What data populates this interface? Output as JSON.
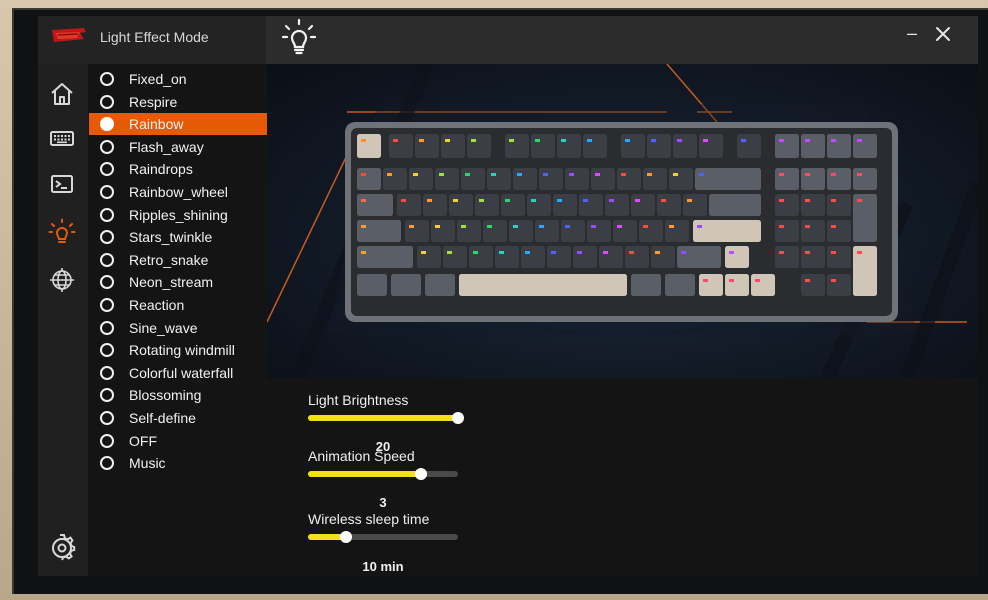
{
  "header": {
    "title": "Light Effect Mode",
    "minimize_label": "–"
  },
  "modes": {
    "selected": "Rainbow",
    "items": [
      {
        "label": "Fixed_on"
      },
      {
        "label": "Respire"
      },
      {
        "label": "Rainbow"
      },
      {
        "label": "Flash_away"
      },
      {
        "label": "Raindrops"
      },
      {
        "label": "Rainbow_wheel"
      },
      {
        "label": "Ripples_shining"
      },
      {
        "label": "Stars_twinkle"
      },
      {
        "label": "Retro_snake"
      },
      {
        "label": "Neon_stream"
      },
      {
        "label": "Reaction"
      },
      {
        "label": "Sine_wave"
      },
      {
        "label": "Rotating windmill"
      },
      {
        "label": "Colorful waterfall"
      },
      {
        "label": "Blossoming"
      },
      {
        "label": "Self-define"
      },
      {
        "label": "OFF"
      },
      {
        "label": "Music"
      }
    ]
  },
  "rail": {
    "items": [
      {
        "icon": "home-icon"
      },
      {
        "icon": "keyboard-icon"
      },
      {
        "icon": "terminal-icon"
      },
      {
        "icon": "lightbulb-icon"
      },
      {
        "icon": "globe-icon"
      }
    ],
    "settings_icon": "gear-icon",
    "active_color": "#e65a06"
  },
  "controls": {
    "brightness": {
      "label": "Light Brightness",
      "value": "20",
      "fraction": 1.0
    },
    "speed": {
      "label": "Animation Speed",
      "value": "3",
      "fraction": 0.75
    },
    "sleep": {
      "label": "Wireless sleep time",
      "value": "10 min",
      "fraction": 0.25
    }
  },
  "colors": {
    "accent": "#e65a06",
    "slider": "#f3e01a"
  }
}
